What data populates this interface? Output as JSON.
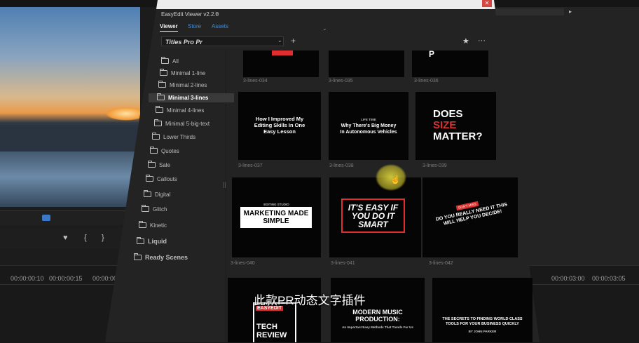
{
  "background": {
    "timecodes": [
      "00:00:00:10",
      "00:00:00:15",
      "00:00:00",
      "00:00:03:00",
      "00:00:03:05"
    ],
    "controls": [
      "♥",
      "{",
      "}"
    ]
  },
  "window": {
    "close": "✕",
    "panel_title": "EasyEdit Viewer v2.2.0",
    "panel_menu": "≡",
    "tabs": [
      "Viewer",
      "Store",
      "Assets"
    ],
    "tab_arrow": "⌄",
    "pack": "Titles Pro Pr",
    "pack_chevron": "⌄",
    "add": "+",
    "star": "★",
    "more": "···",
    "split": "||"
  },
  "folders": [
    "All",
    "Minimal 1-line",
    "Minimal 2-lines",
    "Minimal 3-lines",
    "Minimal 4-lines",
    "Minimal 5-big-text",
    "Lower Thirds",
    "Quotes",
    "Sale",
    "Callouts",
    "Digital",
    "Glitch",
    "Kinetic",
    "Liquid",
    "Ready Scenes"
  ],
  "selected_folder": "Minimal 3-lines",
  "cards": {
    "labels": [
      "3-lines-034",
      "3-lines-035",
      "3-lines-036",
      "3-lines-037",
      "3-lines-038",
      "3-lines-039",
      "3-lines-040",
      "3-lines-041",
      "3-lines-042"
    ],
    "c1": "P",
    "c37": "How I Improved My Editing Skills In One Easy Lesson",
    "c38_small": "LIFE TIME",
    "c38": "Why There's Big Money In Autonomous Vehicles",
    "c39": [
      "DOES",
      "SIZE",
      "MATTER?"
    ],
    "c40_small": "EDITING STUDIO",
    "c40": "MARKETING MADE SIMPLE",
    "c41": "IT'S EASY IF YOU DO IT SMART",
    "c42_small": "DON'T MISS",
    "c42": "DO YOU REALLY NEED IT THIS WILL HELP YOU DECIDE!",
    "c43_brand": "EASYEDIT",
    "c43": "TECH REVIEW",
    "c44": "MODERN MUSIC PRODUCTION:",
    "c44_sub": "An Important Easy Methods That Trends For Us",
    "c45": "THE SECRETS TO FINDING WORLD CLASS TOOLS FOR YOUR BUSINESS QUICKLY",
    "c45_sub": "BY JOHN PARKER"
  },
  "caption": "此款PR动态文字插件",
  "colors": {
    "accent_blue": "#3f8fd9",
    "highlight_red": "#e02d2d",
    "close_red": "#d64541",
    "cursor_yellow": "#d6cd3c"
  }
}
